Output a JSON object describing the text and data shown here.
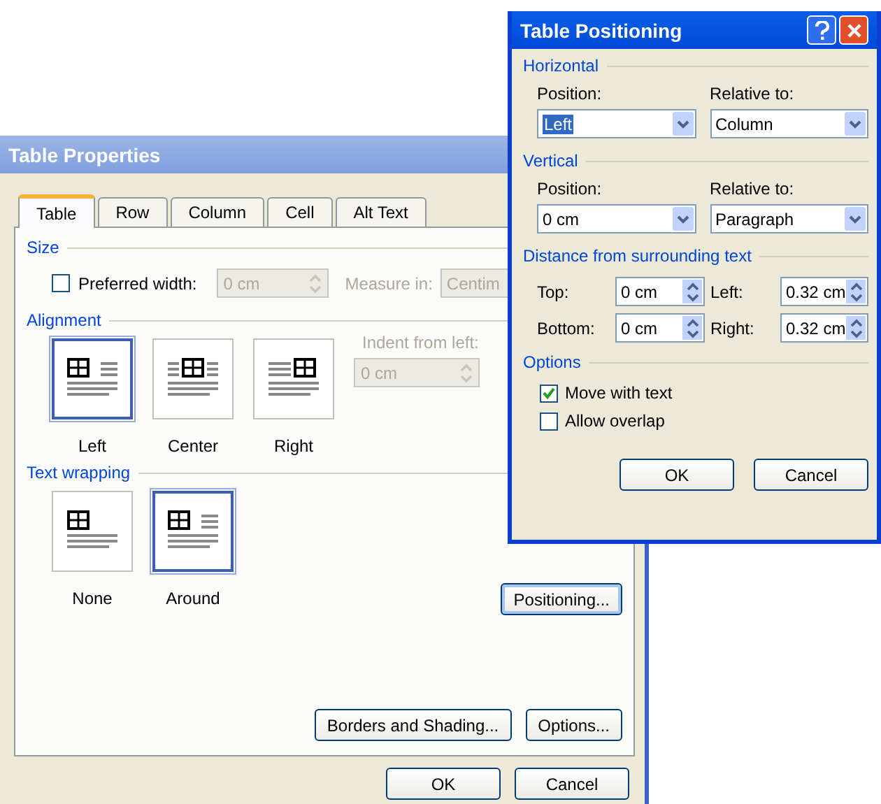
{
  "table_properties": {
    "title": "Table Properties",
    "tabs": [
      {
        "label": "Table",
        "selected": true
      },
      {
        "label": "Row",
        "selected": false
      },
      {
        "label": "Column",
        "selected": false
      },
      {
        "label": "Cell",
        "selected": false
      },
      {
        "label": "Alt Text",
        "selected": false
      }
    ],
    "size": {
      "heading": "Size",
      "preferred_width": {
        "label": "Preferred width:",
        "checked": false,
        "value": "0 cm",
        "disabled": true
      },
      "measure_in": {
        "label": "Measure in:",
        "value": "Centim",
        "disabled": true
      }
    },
    "alignment": {
      "heading": "Alignment",
      "options": [
        {
          "kind": "left",
          "label": "Left",
          "selected": true
        },
        {
          "kind": "center",
          "label": "Center",
          "selected": false
        },
        {
          "kind": "right",
          "label": "Right",
          "selected": false
        }
      ],
      "indent": {
        "label": "Indent from left:",
        "value": "0 cm",
        "disabled": true
      }
    },
    "text_wrapping": {
      "heading": "Text wrapping",
      "options": [
        {
          "kind": "none",
          "label": "None",
          "selected": false
        },
        {
          "kind": "around",
          "label": "Around",
          "selected": true
        }
      ]
    },
    "positioning_button": "Positioning...",
    "borders_button": "Borders and Shading...",
    "options_button": "Options...",
    "buttons": [
      "OK",
      "Cancel"
    ]
  },
  "table_positioning": {
    "title": "Table Positioning",
    "horizontal": {
      "heading": "Horizontal",
      "position": {
        "label": "Position:",
        "value": "Left"
      },
      "relative_to": {
        "label": "Relative to:",
        "value": "Column"
      }
    },
    "vertical": {
      "heading": "Vertical",
      "position": {
        "label": "Position:",
        "value": "0 cm"
      },
      "relative_to": {
        "label": "Relative to:",
        "value": "Paragraph"
      }
    },
    "distance": {
      "heading": "Distance from surrounding text",
      "fields": [
        {
          "label": "Top:",
          "value": "0 cm"
        },
        {
          "label": "Left:",
          "value": "0.32 cm"
        },
        {
          "label": "Bottom:",
          "value": "0 cm"
        },
        {
          "label": "Right:",
          "value": "0.32 cm"
        }
      ]
    },
    "options": {
      "heading": "Options",
      "items": [
        {
          "label": "Move with text",
          "checked": true
        },
        {
          "label": "Allow overlap",
          "checked": false
        }
      ]
    },
    "buttons": [
      "OK",
      "Cancel"
    ]
  }
}
